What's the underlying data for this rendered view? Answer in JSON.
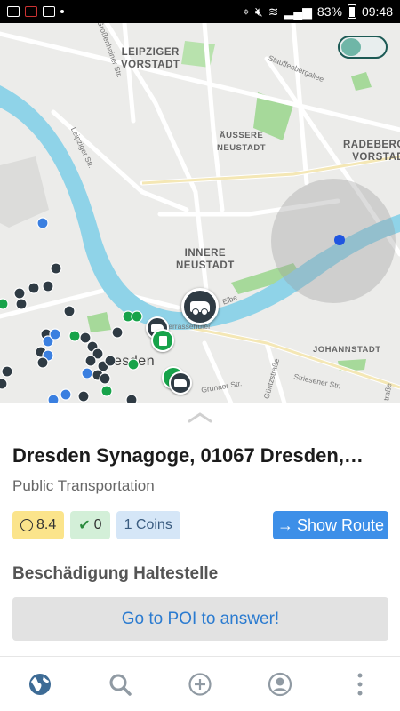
{
  "status_bar": {
    "battery": "83%",
    "time": "09:48"
  },
  "map": {
    "districts": [
      {
        "name": "leipziger-vorstadt",
        "text": "LEIPZIGER\nVORSTADT"
      },
      {
        "name": "aeussere-neustadt",
        "text": "ÄUSSERE\nNEUSTADT"
      },
      {
        "name": "radeberger-vorstadt",
        "text": "RADEBERGER\nVORSTADT"
      },
      {
        "name": "innere-neustadt",
        "text": "INNERE\nNEUSTADT"
      },
      {
        "name": "johannstadt",
        "text": "JOHANNSTADT"
      },
      {
        "name": "dresden",
        "text": "esden"
      }
    ],
    "streets": [
      {
        "text": "Großenhainer Str."
      },
      {
        "text": "Stauffenbergallee"
      },
      {
        "text": "Leipziger Str."
      },
      {
        "text": "Elbe"
      },
      {
        "text": "Grunaer Str."
      },
      {
        "text": "Güntzstraße"
      },
      {
        "text": "Striesener Str."
      },
      {
        "text": "Terrassenufer"
      },
      {
        "text": "traße"
      }
    ],
    "toggle_on": true,
    "colors": {
      "river": "#8fd3e8",
      "park": "#a6d99a",
      "land": "#ececea",
      "road": "#ffffff"
    }
  },
  "poi": {
    "title": "Dresden Synagoge, 01067 Dresden,…",
    "category": "Public Transportation",
    "score": "8.4",
    "confirmations": "0",
    "coins": "1 Coins",
    "show_route_label": "Show Route",
    "question": "Beschädigung Haltestelle",
    "answer_label": "Go to POI to answer!"
  },
  "nav": {
    "items": [
      "globe-icon",
      "search-icon",
      "add-icon",
      "profile-icon",
      "more-icon"
    ]
  }
}
